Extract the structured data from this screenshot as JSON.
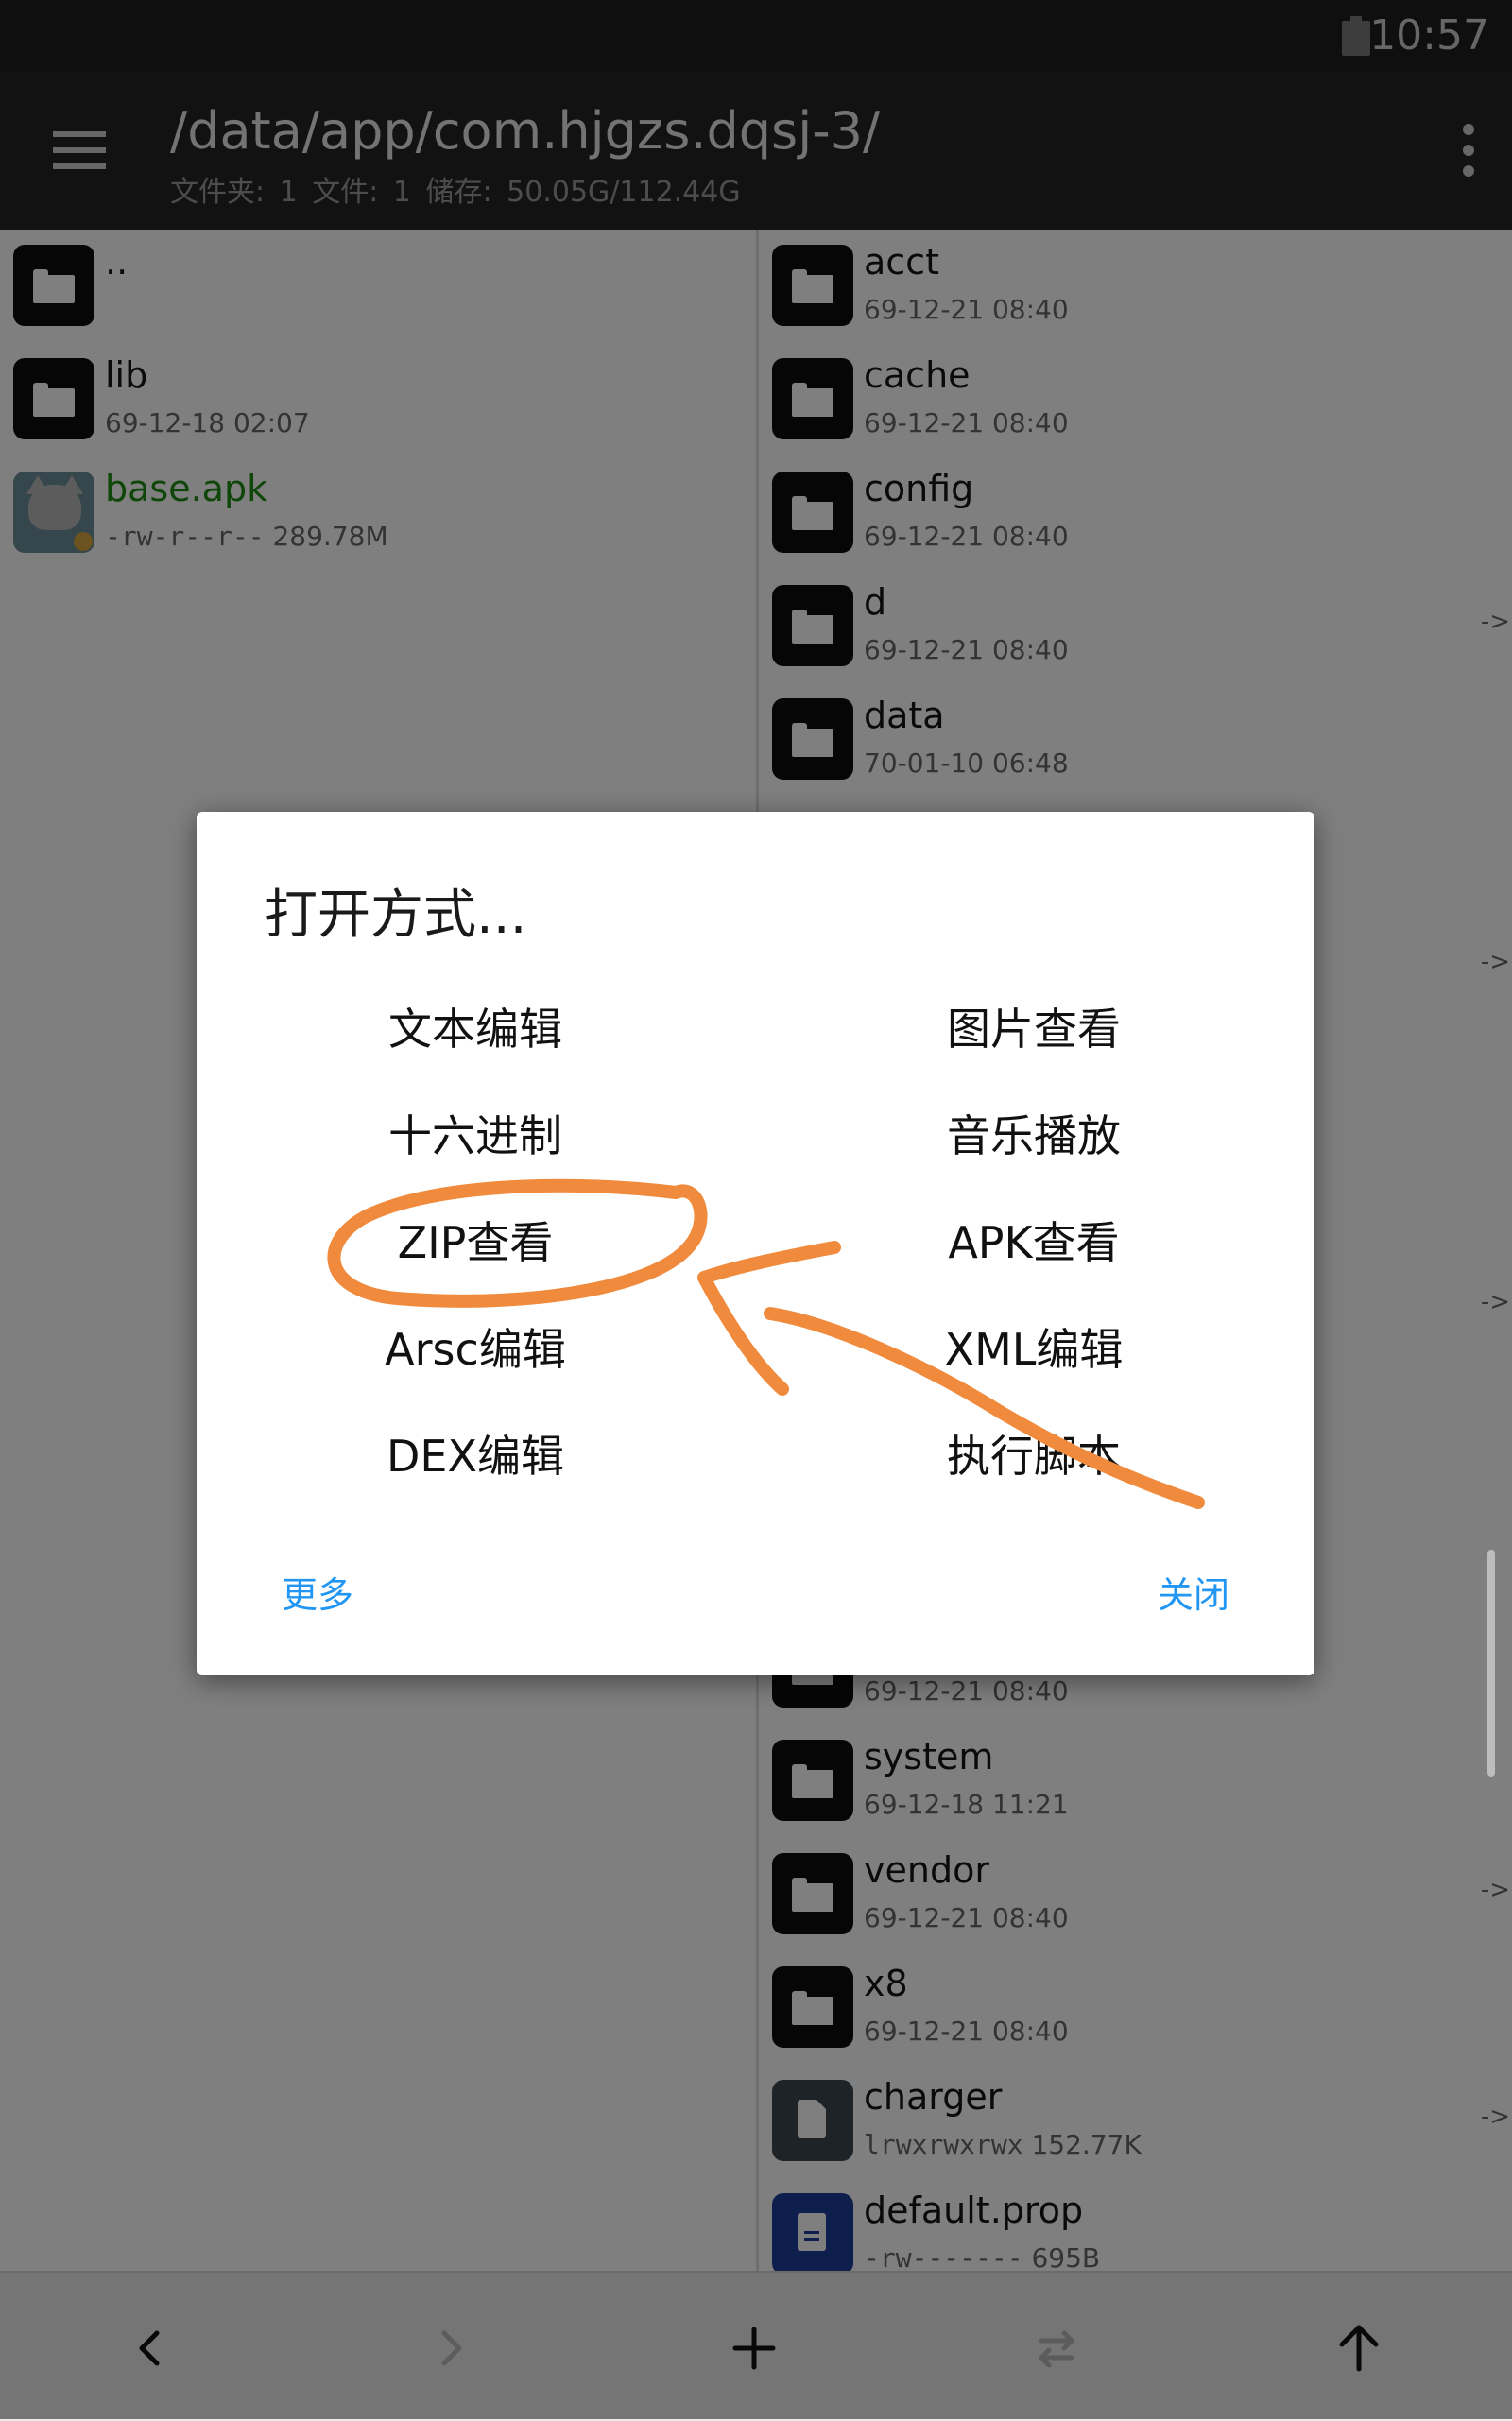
{
  "status_bar": {
    "time": "10:57",
    "battery_icon": "battery-icon"
  },
  "toolbar": {
    "menu_icon": "hamburger-menu-icon",
    "path": "/data/app/com.hjgzs.dqsj-3/",
    "summary": "文件夹: 1  文件: 1  储存: 50.05G/112.44G",
    "more_icon": "more-vert-icon"
  },
  "left_pane": {
    "items": [
      {
        "name": "..",
        "meta": "",
        "icon": "folder-icon"
      },
      {
        "name": "lib",
        "meta": "69-12-18 02:07",
        "icon": "folder-icon"
      },
      {
        "name": "base.apk",
        "perm": "-rw-r--r--",
        "size": "289.78M",
        "icon": "apk-icon",
        "color": "#1f8c12"
      }
    ]
  },
  "right_pane": {
    "items": [
      {
        "name": "acct",
        "meta": "69-12-21 08:40",
        "icon": "folder-icon"
      },
      {
        "name": "cache",
        "meta": "69-12-21 08:40",
        "icon": "folder-icon"
      },
      {
        "name": "config",
        "meta": "69-12-21 08:40",
        "icon": "folder-icon"
      },
      {
        "name": "d",
        "meta": "69-12-21 08:40",
        "icon": "folder-icon",
        "link": "->"
      },
      {
        "name": "data",
        "meta": "70-01-10 06:48",
        "icon": "folder-icon"
      },
      {
        "name": "system",
        "meta": "69-12-18 11:21",
        "icon": "folder-icon"
      },
      {
        "name": "vendor",
        "meta": "69-12-21 08:40",
        "icon": "folder-icon",
        "link": "->"
      },
      {
        "name": "x8",
        "meta": "69-12-21 08:40",
        "icon": "folder-icon"
      },
      {
        "name": "charger",
        "perm": "lrwxrwxrwx",
        "size": "152.77K",
        "icon": "file-icon",
        "link": "->"
      },
      {
        "name": "default.prop",
        "perm": "-rw-------",
        "size": "695B",
        "icon": "document-icon"
      }
    ],
    "partial_meta": "69-12-21 08:40",
    "extra_link_arrows": [
      "->",
      "->"
    ]
  },
  "dialog": {
    "title": "打开方式...",
    "options": [
      "文本编辑",
      "图片查看",
      "十六进制",
      "音乐播放",
      "ZIP查看",
      "APK查看",
      "Arsc编辑",
      "XML编辑",
      "DEX编辑",
      "执行脚本"
    ],
    "more_button": "更多",
    "close_button": "关闭"
  },
  "bottom_bar": {
    "icons": [
      "back-arrow-icon",
      "forward-arrow-icon",
      "add-icon",
      "swap-icon",
      "up-arrow-icon"
    ]
  },
  "colors": {
    "accent": "#2196f3",
    "apk_name": "#1f8c12",
    "annotation": "#f08a3c",
    "toolbar": "#252525"
  }
}
